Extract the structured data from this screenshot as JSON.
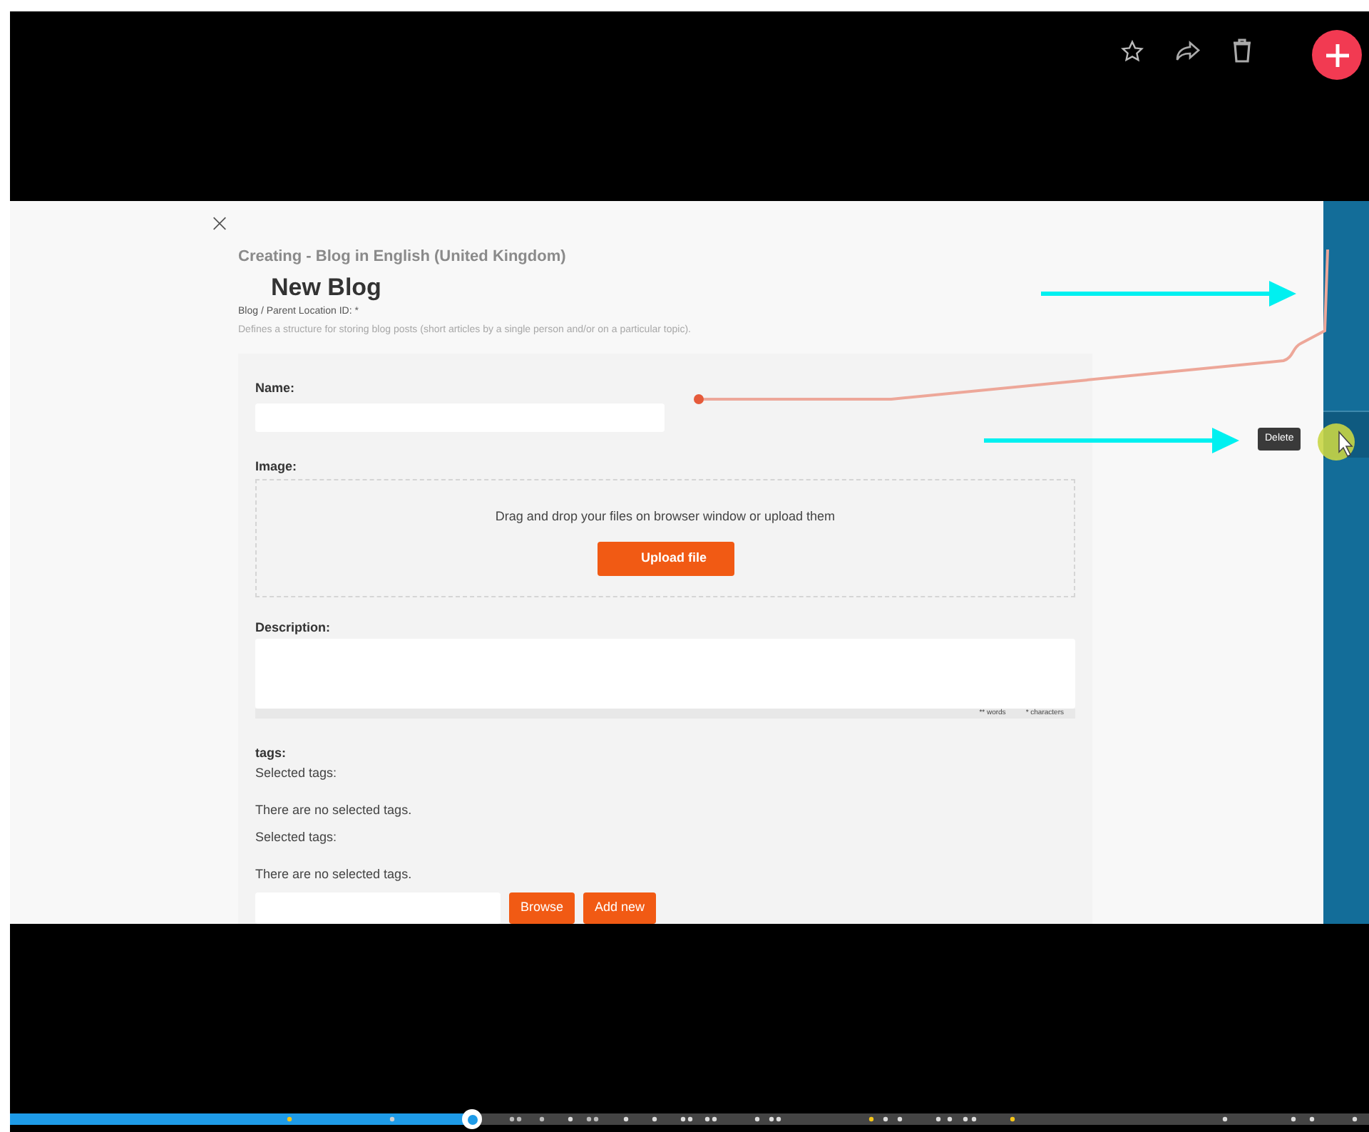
{
  "video_frame": {
    "header": {
      "subtitle": "Creating - Blog in English (United Kingdom)",
      "title": "New Blog",
      "location_label": "Blog / Parent Location ID: *",
      "description": "Defines a structure for storing blog posts (short articles by a single person and/or on a particular topic)."
    },
    "form": {
      "name_label": "Name:",
      "image_label": "Image:",
      "dropzone_text": "Drag and drop your files on browser window or upload them",
      "upload_button": "Upload file",
      "description_label": "Description:",
      "word_count": "** words",
      "char_count": "* characters",
      "tags_label": "tags:",
      "tag_groups": [
        {
          "label": "Selected tags:",
          "empty_text": "There are no selected tags."
        },
        {
          "label": "Selected tags:",
          "empty_text": "There are no selected tags."
        }
      ],
      "tag_buttons": [
        "Browse",
        "Add new"
      ]
    },
    "tooltip": "Delete"
  },
  "progress": {
    "level": 0.34
  }
}
